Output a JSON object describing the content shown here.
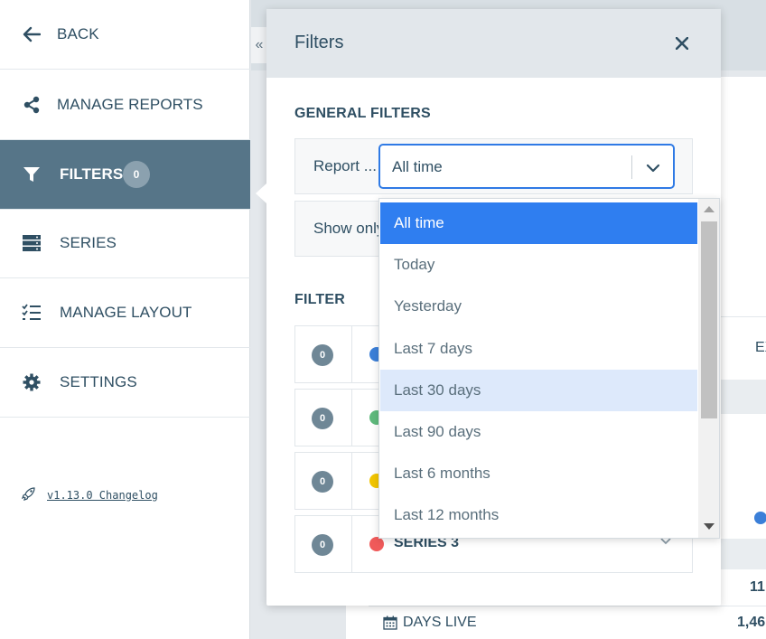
{
  "sidebar": {
    "back": "BACK",
    "manage_reports": "MANAGE REPORTS",
    "filters": "FILTERS",
    "filters_badge": "0",
    "series": "SERIES",
    "manage_layout": "MANAGE LAYOUT",
    "settings": "SETTINGS",
    "changelog": "v1.13.0 Changelog"
  },
  "background": {
    "partial_label": "EX",
    "partial_value": "11",
    "days_live_label": "DAYS LIVE",
    "days_live_value": "1,46"
  },
  "modal": {
    "title": "Filters",
    "general_filters_title": "GENERAL FILTERS",
    "report_label": "Report ...",
    "report_selected": "All time",
    "show_only_label": "Show only",
    "filter_title": "FILTER",
    "series": [
      {
        "count": "0",
        "color": "#3b7fd8",
        "name": ""
      },
      {
        "count": "0",
        "color": "#5fba7d",
        "name": ""
      },
      {
        "count": "0",
        "color": "#f2c500",
        "name": ""
      },
      {
        "count": "0",
        "color": "#f05a5a",
        "name": "SERIES 3"
      }
    ]
  },
  "dropdown": {
    "options": [
      "All time",
      "Today",
      "Yesterday",
      "Last 7 days",
      "Last 30 days",
      "Last 90 days",
      "Last 6 months",
      "Last 12 months"
    ],
    "selected": "All time",
    "hovered": "Last 30 days"
  },
  "colors": {
    "sidebar_active": "#567588",
    "accent_blue": "#2f7ef0",
    "text_primary": "#2f4f63"
  }
}
